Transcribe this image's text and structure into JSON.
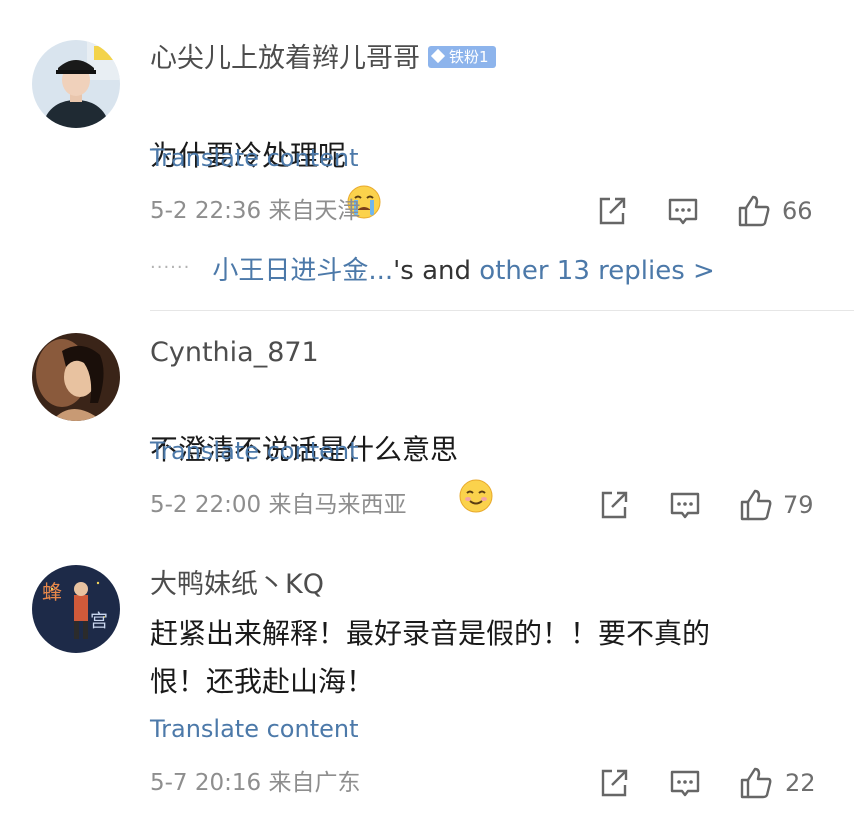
{
  "comments": [
    {
      "username": "心尖儿上放着辫儿哥哥",
      "badge": "铁粉1",
      "text": "为什要冷处理呢",
      "translate": "Translate content",
      "date": "5-2 22:36",
      "location": "来自天津",
      "likes": "66",
      "emoji": "crying-emoji"
    },
    {
      "username": "Cynthia_871",
      "text": "不澄清不说话是什么意思",
      "translate": "Translate content",
      "date": "5-2 22:00",
      "location": "来自马来西亚",
      "likes": "79",
      "emoji": "smiling-emoji"
    },
    {
      "username": "大鸭妹纸丶KQ",
      "text": "赶紧出来解释！最好录音是假的！！要不真的\n恨！还我赴山海！",
      "translate": "Translate content",
      "date": "5-7 20:16",
      "location": "来自广东",
      "likes": "22"
    }
  ],
  "replies": {
    "dots": "······",
    "name": "小王日进斗金...",
    "middle": "'s and ",
    "more": "other 13 replies >"
  },
  "icons": {
    "share": "share-icon",
    "comment": "comment-icon",
    "like": "like-icon"
  },
  "colors": {
    "link": "#4c79a9",
    "badge": "#8db4ec",
    "meta": "#8e8e8e"
  }
}
